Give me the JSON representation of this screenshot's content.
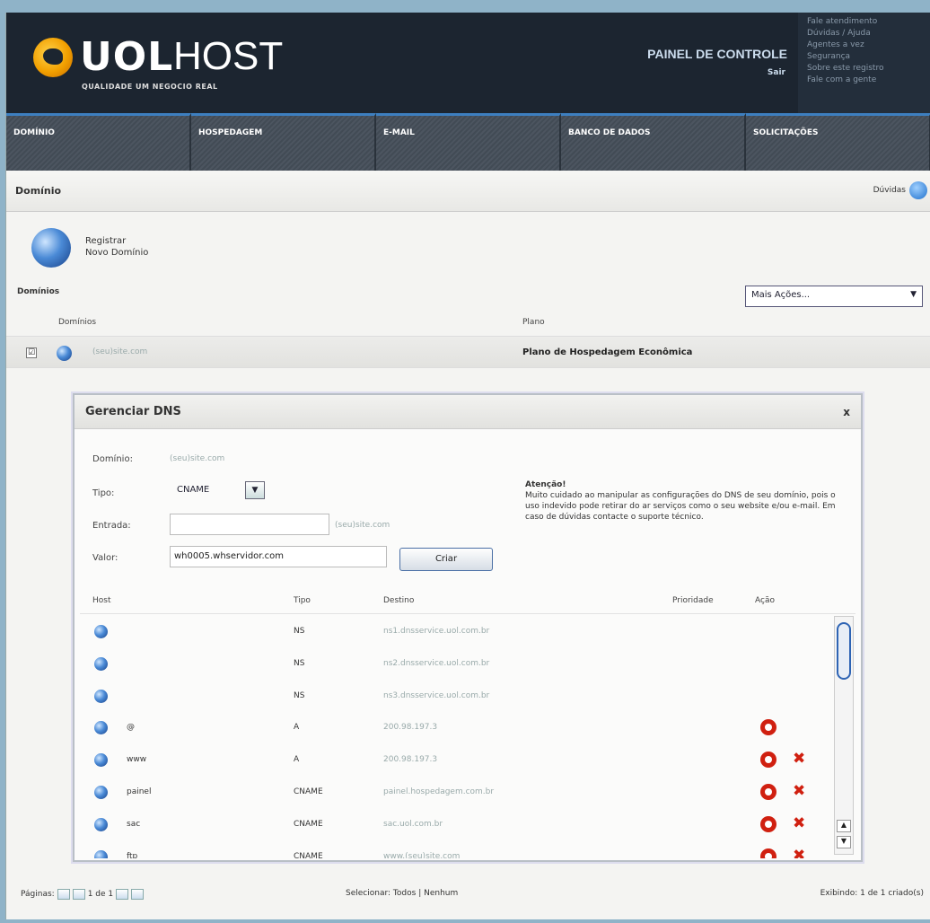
{
  "header": {
    "logo_uol": "UOL",
    "logo_host": "HOST",
    "tagline": "QUALIDADE UM NEGOCIO REAL",
    "panel_title": "PAINEL DE CONTROLE",
    "panel_sub": "Sair",
    "links": [
      "Fale atendimento",
      "Dúvidas / Ajuda",
      "Agentes a vez",
      "Segurança",
      "Sobre este registro",
      "Fale com a gente"
    ]
  },
  "nav": {
    "tabs": [
      "DOMÍNIO",
      "HOSPEDAGEM",
      "E-MAIL",
      "BANCO DE DADOS",
      "SOLICITAÇÕES"
    ]
  },
  "page": {
    "title": "Domínio",
    "help_label": "Dúvidas",
    "register_label_1": "Registrar",
    "register_label_2": "Novo Domínio",
    "domains_label": "Domínios",
    "more_actions": "Mais Ações..."
  },
  "domain_table": {
    "col_domain": "Domínios",
    "col_plan": "Plano",
    "row": {
      "checked": "☑",
      "name": "(seu)site.com",
      "plan": "Plano de Hospedagem Econômica"
    }
  },
  "dialog": {
    "title": "Gerenciar DNS",
    "close": "x",
    "domain_label": "Domínio:",
    "domain_value": "(seu)site.com",
    "type_label": "Tipo:",
    "type_value": "CNAME",
    "entry_label": "Entrada:",
    "entry_suffix": "(seu)site.com",
    "value_label": "Valor:",
    "value_value": "wh0005.whservidor.com",
    "create_button": "Criar",
    "warning_title": "Atenção!",
    "warning_text": "Muito cuidado ao manipular as configurações do DNS de seu domínio, pois o uso indevido pode retirar do ar serviços como o seu website e/ou e-mail. Em caso de dúvidas contacte o suporte técnico.",
    "col_host": "Host",
    "col_type": "Tipo",
    "col_dest": "Destino",
    "col_priority": "Prioridade",
    "col_action": "Ação",
    "rows": [
      {
        "host": "",
        "type": "NS",
        "dest": "ns1.dnsservice.uol.com.br",
        "edit": false,
        "del": false
      },
      {
        "host": "",
        "type": "NS",
        "dest": "ns2.dnsservice.uol.com.br",
        "edit": false,
        "del": false
      },
      {
        "host": "",
        "type": "NS",
        "dest": "ns3.dnsservice.uol.com.br",
        "edit": false,
        "del": false
      },
      {
        "host": "@",
        "type": "A",
        "dest": "200.98.197.3",
        "edit": true,
        "del": false
      },
      {
        "host": "www",
        "type": "A",
        "dest": "200.98.197.3",
        "edit": true,
        "del": true
      },
      {
        "host": "painel",
        "type": "CNAME",
        "dest": "painel.hospedagem.com.br",
        "edit": true,
        "del": true
      },
      {
        "host": "sac",
        "type": "CNAME",
        "dest": "sac.uol.com.br",
        "edit": true,
        "del": true
      },
      {
        "host": "ftp",
        "type": "CNAME",
        "dest": "www.(seu)site.com",
        "edit": true,
        "del": true
      }
    ]
  },
  "footer": {
    "pages_label": "Páginas:",
    "page_info": "1 de 1",
    "select_label": "Selecionar:",
    "select_all": "Todos",
    "select_sep": "|",
    "select_none": "Nenhum",
    "showing": "Exibindo: 1 de 1 criado(s)"
  },
  "colors": {
    "header_bg": "#1c2530",
    "accent": "#3d7fc0",
    "delete_red": "#d02010"
  }
}
